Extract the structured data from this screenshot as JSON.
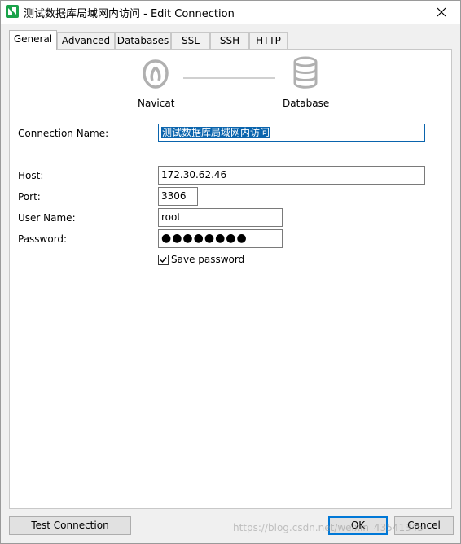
{
  "window": {
    "title": "测试数据库局域网内访问 - Edit Connection",
    "accent_color": "#0a64ad",
    "icons": {
      "app": "navicat-app-icon",
      "close": "close-icon"
    }
  },
  "tabs": [
    {
      "label": "General",
      "active": true
    },
    {
      "label": "Advanced",
      "active": false
    },
    {
      "label": "Databases",
      "active": false
    },
    {
      "label": "SSL",
      "active": false
    },
    {
      "label": "SSH",
      "active": false
    },
    {
      "label": "HTTP",
      "active": false
    }
  ],
  "diagram": {
    "left_label": "Navicat",
    "right_label": "Database",
    "left_icon": "navicat-logo-icon",
    "right_icon": "database-icon"
  },
  "form": {
    "connection_name": {
      "label": "Connection Name:",
      "value": "测试数据库局域网内访问"
    },
    "host": {
      "label": "Host:",
      "value": "172.30.62.46"
    },
    "port": {
      "label": "Port:",
      "value": "3306"
    },
    "user_name": {
      "label": "User Name:",
      "value": "root"
    },
    "password": {
      "label": "Password:",
      "value": "●●●●●●●●"
    },
    "save_password": {
      "label": "Save password",
      "checked": true
    }
  },
  "footer": {
    "test_connection": "Test Connection",
    "ok": "OK",
    "cancel": "Cancel"
  },
  "watermark": "https://blog.csdn.net/weixin_43541345"
}
